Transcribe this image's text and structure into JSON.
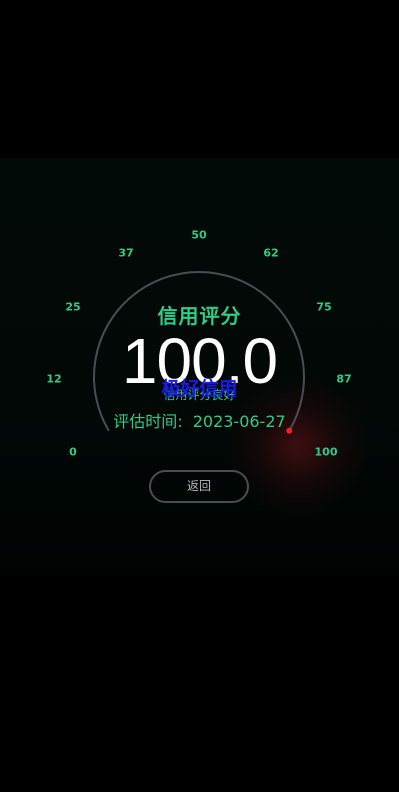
{
  "gauge": {
    "ticks": [
      "0",
      "12",
      "25",
      "37",
      "50",
      "62",
      "75",
      "87",
      "100"
    ],
    "value": 100.0,
    "min": 0,
    "max": 100
  },
  "score": {
    "title": "信用评分",
    "value": "100.0",
    "level_label": "信用评分良好",
    "level_overlay": "极好信用",
    "time_label": "评估时间:",
    "time_value": "2023-06-27"
  },
  "actions": {
    "back_label": "返回"
  },
  "colors": {
    "accent": "#2ecc8a",
    "arc": "#4a4d52",
    "pointer": "#ee2222",
    "overlay_text": "#1a1aee"
  }
}
